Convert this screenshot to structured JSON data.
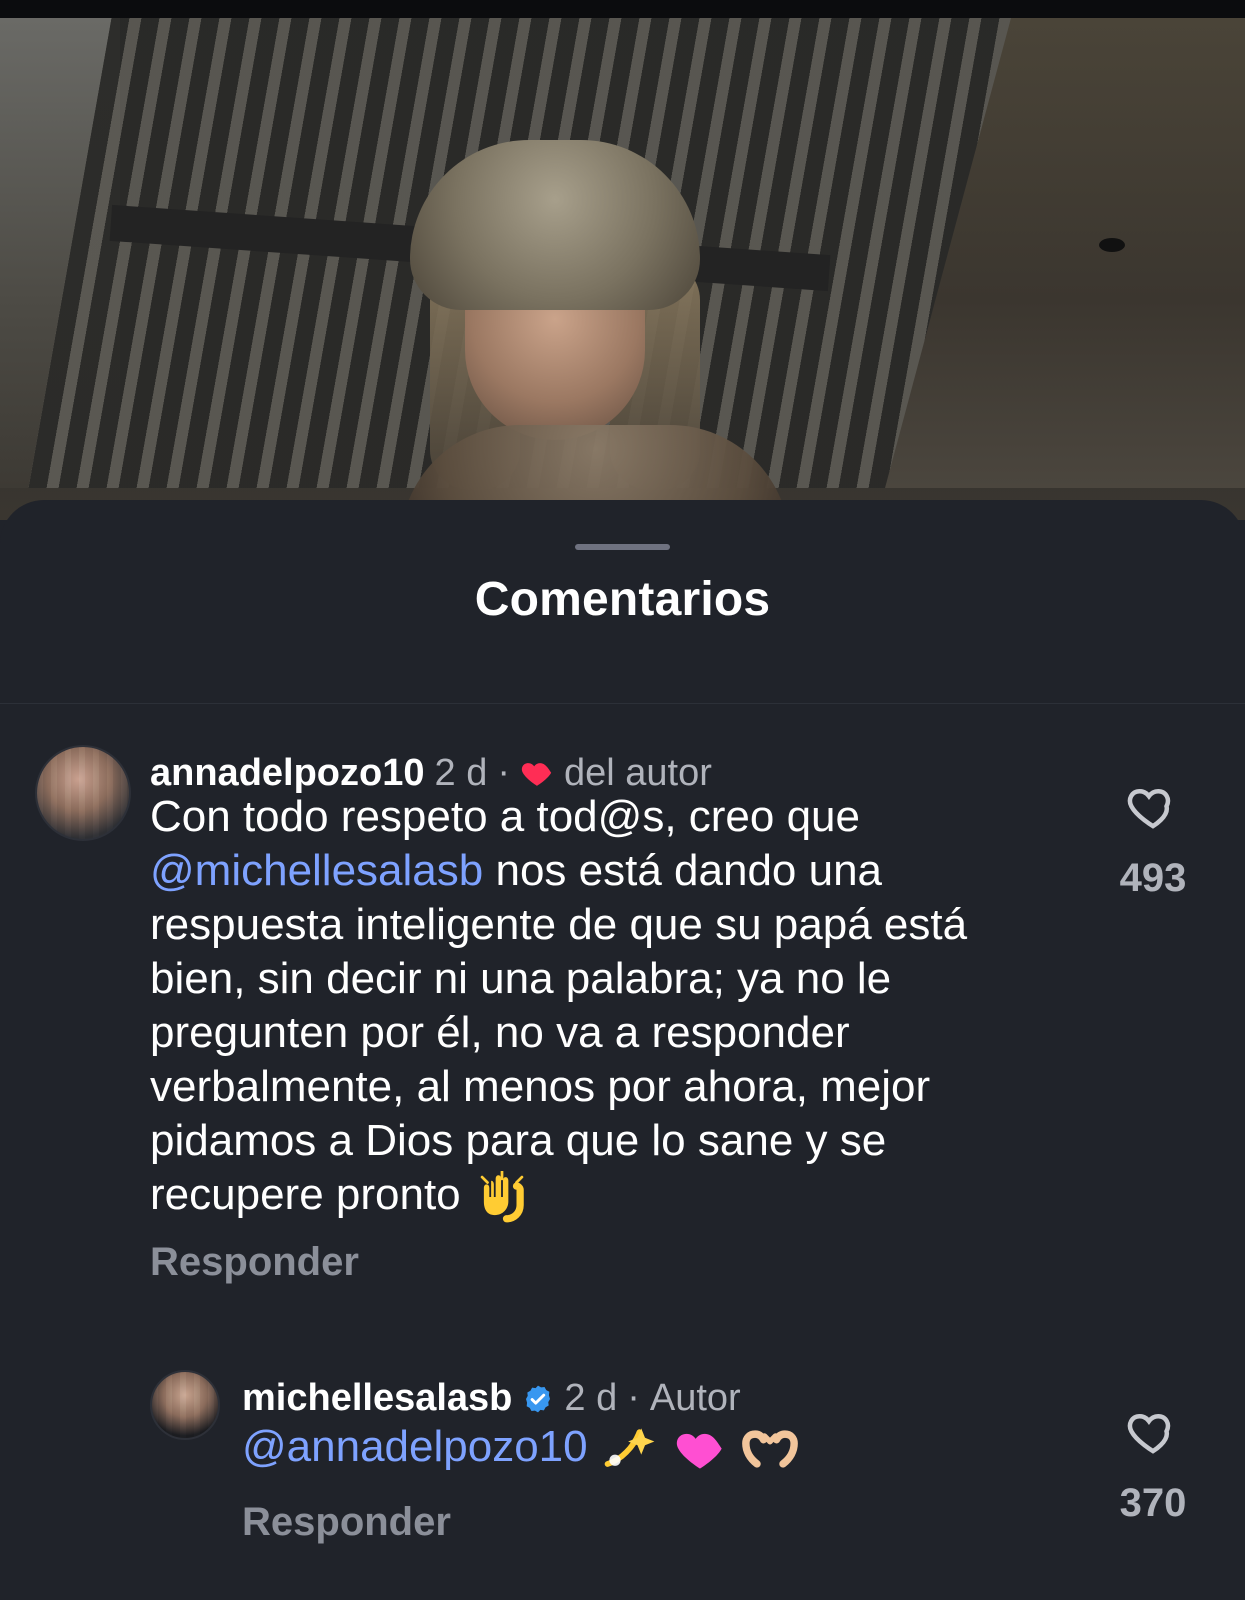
{
  "sheet": {
    "title": "Comentarios"
  },
  "comments": [
    {
      "username": "annadelpozo10",
      "time": "2 d",
      "separator": "·",
      "liked_by_author_label": "del autor",
      "text_part_1": "Con todo respeto a tod@s, creo que",
      "mention": "@michellesalasb",
      "text_part_2": "nos está dando una respuesta inteligente de que su papá está bien, sin decir ni una palabra; ya no le pregunten por él, no va a responder verbalmente, al menos por ahora, mejor pidamos a Dios para que lo sane y se recupere pronto",
      "reply_label": "Responder",
      "like_count": "493",
      "icons": {
        "author_like_heart": "heart-red-icon",
        "emoji": "raised-hands-emoji"
      }
    },
    {
      "username": "michellesalasb",
      "time": "2 d",
      "separator": "·",
      "author_badge": "Autor",
      "mention": "@annadelpozo10",
      "reply_label": "Responder",
      "like_count": "370",
      "icons": {
        "verified": "verified-badge-icon",
        "emojis": [
          "dizzy-emoji",
          "pink-heart-emoji",
          "hand-heart-emoji"
        ]
      }
    }
  ]
}
